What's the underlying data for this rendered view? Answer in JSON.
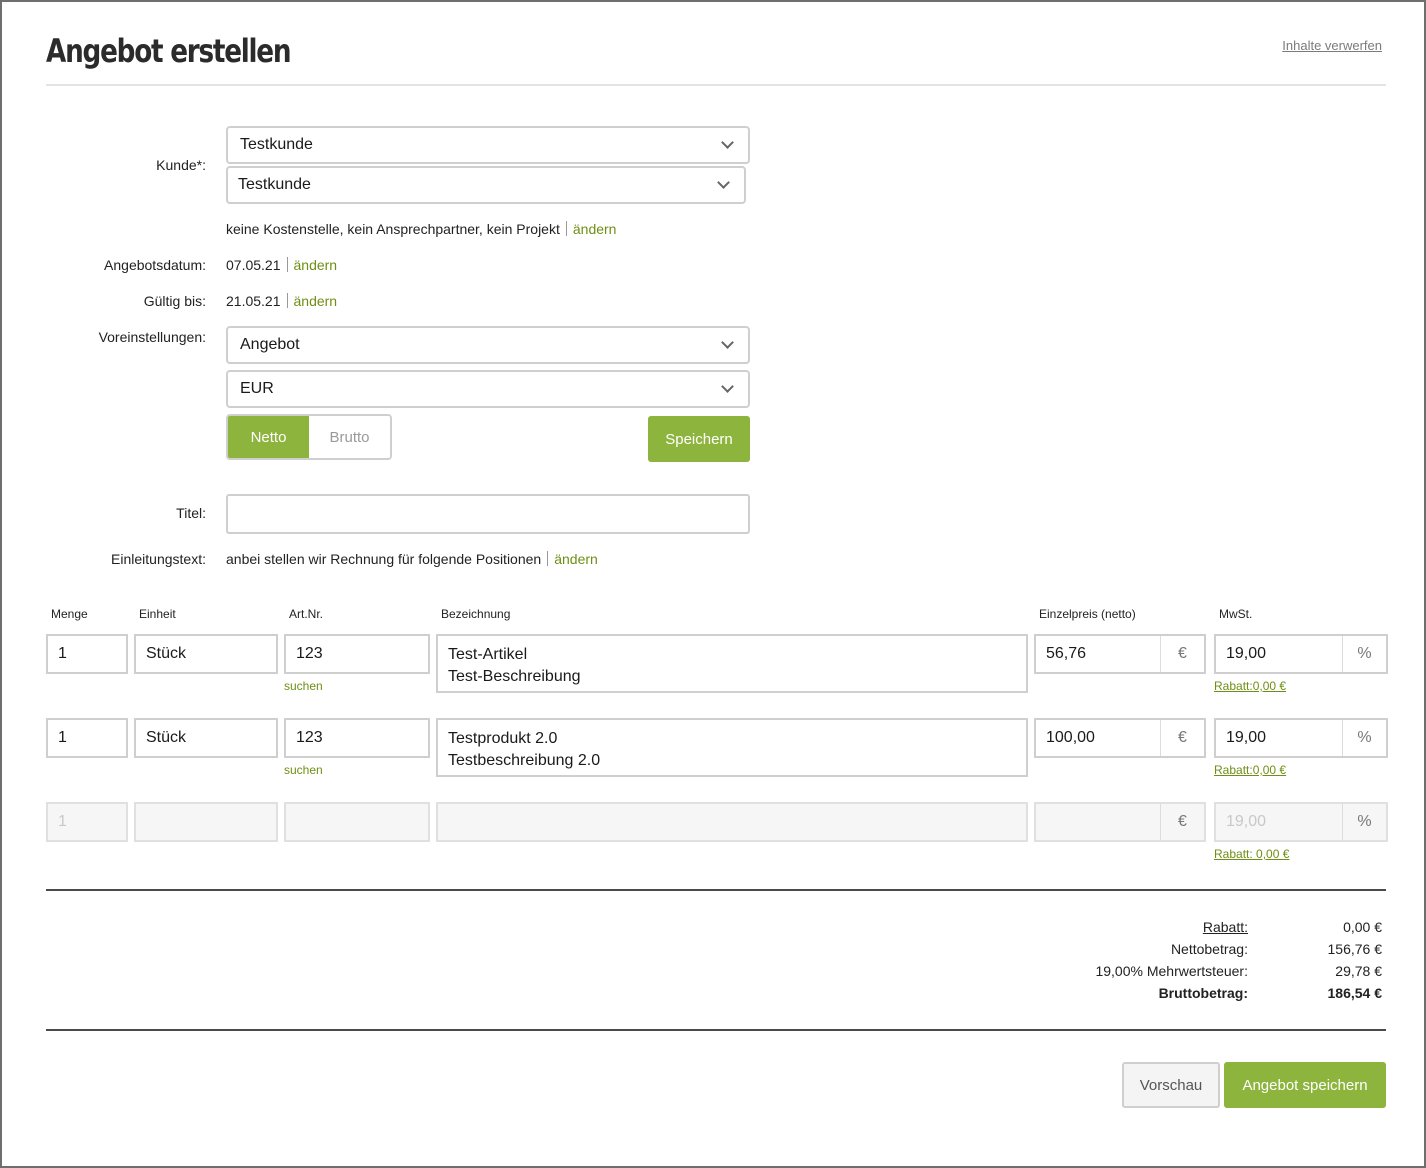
{
  "header": {
    "title": "Angebot erstellen",
    "discard_label": "Inhalte verwerfen"
  },
  "customer": {
    "label": "Kunde*:",
    "select1": "Testkunde",
    "select2": "Testkunde",
    "details": "keine Kostenstelle, kein Ansprechpartner, kein Projekt",
    "change": "ändern"
  },
  "offer_date": {
    "label": "Angebotsdatum:",
    "value": "07.05.21",
    "change": "ändern"
  },
  "valid_until": {
    "label": "Gültig bis:",
    "value": "21.05.21",
    "change": "ändern"
  },
  "presets": {
    "label": "Voreinstellungen:",
    "template": "Angebot",
    "currency": "EUR",
    "netto": "Netto",
    "brutto": "Brutto",
    "save": "Speichern"
  },
  "title_field": {
    "label": "Titel:",
    "value": ""
  },
  "intro": {
    "label": "Einleitungstext:",
    "value": "anbei stellen wir Rechnung für folgende Positionen",
    "change": "ändern"
  },
  "table": {
    "headers": {
      "qty": "Menge",
      "unit": "Einheit",
      "artnr": "Art.Nr.",
      "desc": "Bezeichnung",
      "price": "Einzelpreis (netto)",
      "vat": "MwSt."
    },
    "currency_symbol": "€",
    "percent_symbol": "%",
    "search_label": "suchen",
    "rows": [
      {
        "qty": "1",
        "unit": "Stück",
        "artnr": "123",
        "name": "Test-Artikel",
        "description": "Test-Beschreibung",
        "price": "56,76",
        "vat": "19,00",
        "discount": "Rabatt:0,00 €"
      },
      {
        "qty": "1",
        "unit": "Stück",
        "artnr": "123",
        "name": "Testprodukt 2.0",
        "description": "Testbeschreibung 2.0",
        "price": "100,00",
        "vat": "19,00",
        "discount": "Rabatt:0,00 €"
      }
    ],
    "empty_row": {
      "qty_placeholder": "1",
      "vat_placeholder": "19,00",
      "discount": "Rabatt: 0,00 €"
    }
  },
  "totals": {
    "discount_label": "Rabatt:",
    "discount_value": "0,00 €",
    "net_label": "Nettobetrag:",
    "net_value": "156,76 €",
    "vat_label": "19,00% Mehrwertsteuer:",
    "vat_value": "29,78 €",
    "gross_label": "Bruttobetrag:",
    "gross_value": "186,54 €"
  },
  "footer": {
    "preview": "Vorschau",
    "save_offer": "Angebot speichern"
  },
  "colors": {
    "accent": "#8db43c",
    "link": "#6e8f14"
  }
}
